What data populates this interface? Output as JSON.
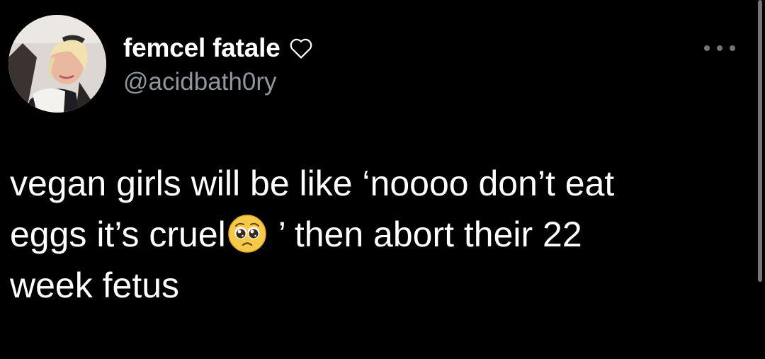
{
  "author": {
    "display_name": "femcel fatale",
    "handle": "@acidbath0ry",
    "badge_icon": "heart-outline-icon",
    "avatar": "avatar-photo"
  },
  "more_icon": "more-options-icon",
  "tweet": {
    "line1": "vegan girls will be like ‘noooo don’t eat",
    "line2_before_emoji": "eggs it’s cruel",
    "emoji": "pleading-face-emoji",
    "line2_after_emoji": " ’ then abort their 22",
    "line3": "week fetus"
  },
  "colors": {
    "background": "#000000",
    "text_primary": "#ffffff",
    "text_secondary": "#8f969c",
    "emoji": "#f7c948"
  }
}
